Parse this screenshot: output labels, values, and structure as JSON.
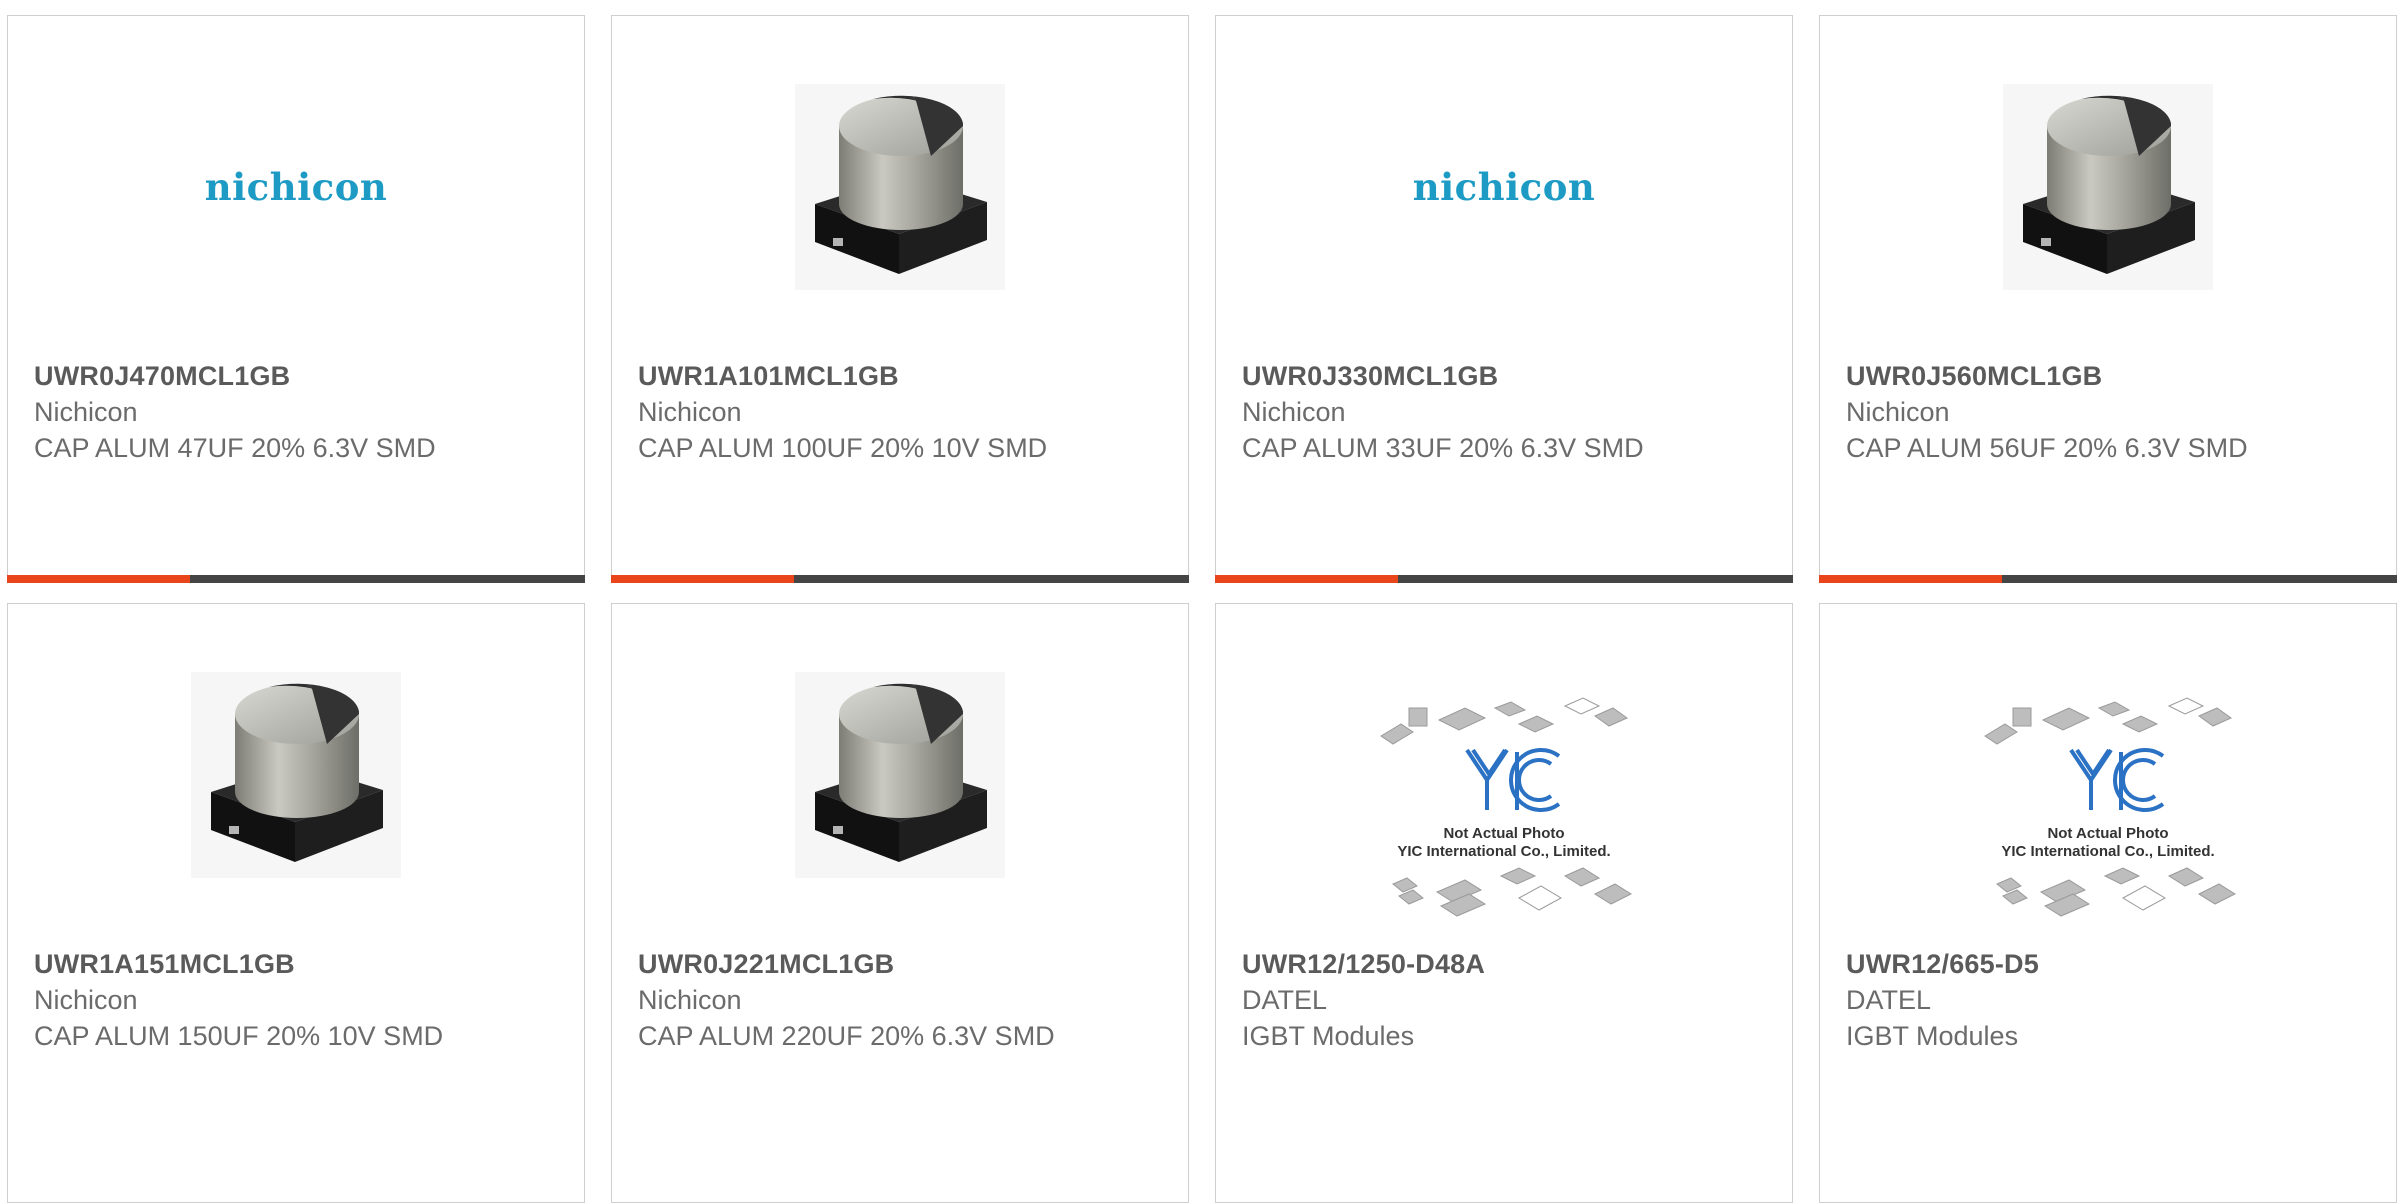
{
  "colors": {
    "accent": "#e9441a",
    "bar": "#454545",
    "brand_nichicon": "#1e9bc4",
    "text_dark": "#5a5a5a",
    "text_light": "#6b6b6b",
    "yic_blue": "#2b72c4"
  },
  "products": [
    {
      "part_number": "UWR0J470MCL1GB",
      "manufacturer": "Nichicon",
      "description": "CAP ALUM 47UF 20% 6.3V SMD",
      "image": "nichicon-logo",
      "logo_text": "nichicon"
    },
    {
      "part_number": "UWR1A101MCL1GB",
      "manufacturer": "Nichicon",
      "description": "CAP ALUM 100UF 20% 10V SMD",
      "image": "smd-capacitor-photo"
    },
    {
      "part_number": "UWR0J330MCL1GB",
      "manufacturer": "Nichicon",
      "description": "CAP ALUM 33UF 20% 6.3V SMD",
      "image": "nichicon-logo",
      "logo_text": "nichicon"
    },
    {
      "part_number": "UWR0J560MCL1GB",
      "manufacturer": "Nichicon",
      "description": "CAP ALUM 56UF 20% 6.3V SMD",
      "image": "smd-capacitor-photo"
    },
    {
      "part_number": "UWR1A151MCL1GB",
      "manufacturer": "Nichicon",
      "description": "CAP ALUM 150UF 20% 10V SMD",
      "image": "smd-capacitor-photo"
    },
    {
      "part_number": "UWR0J221MCL1GB",
      "manufacturer": "Nichicon",
      "description": "CAP ALUM 220UF 20% 6.3V SMD",
      "image": "smd-capacitor-photo"
    },
    {
      "part_number": "UWR12/1250-D48A",
      "manufacturer": "DATEL",
      "description": "IGBT Modules",
      "image": "yic-placeholder",
      "placeholder_line1": "Not Actual Photo",
      "placeholder_line2": "YIC International Co., Limited."
    },
    {
      "part_number": "UWR12/665-D5",
      "manufacturer": "DATEL",
      "description": "IGBT Modules",
      "image": "yic-placeholder",
      "placeholder_line1": "Not Actual Photo",
      "placeholder_line2": "YIC International Co., Limited."
    }
  ]
}
